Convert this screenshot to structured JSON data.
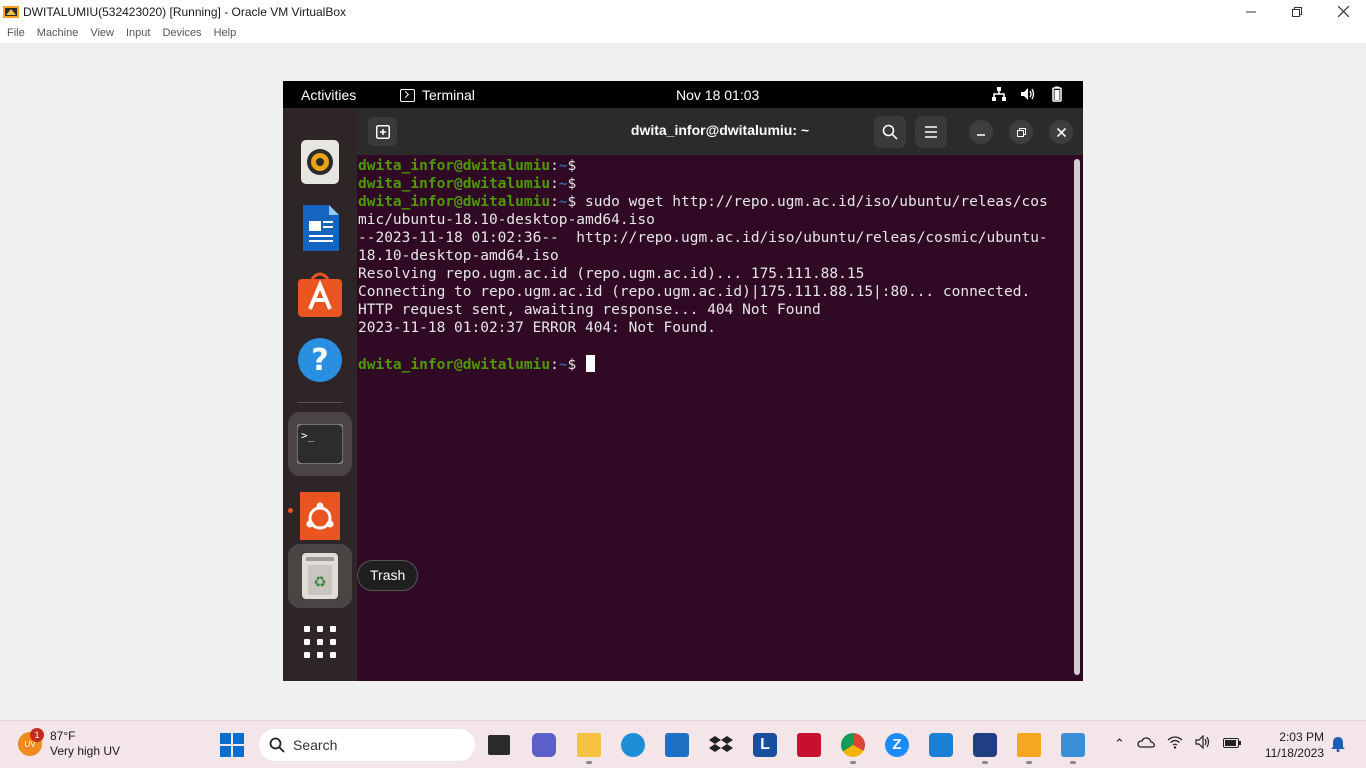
{
  "vbox": {
    "title": "DWITALUMIU(532423020) [Running] - Oracle VM VirtualBox",
    "menu": [
      "File",
      "Machine",
      "View",
      "Input",
      "Devices",
      "Help"
    ]
  },
  "ubuntu": {
    "activities": "Activities",
    "app_menu": "Terminal",
    "clock": "Nov 18  01:03",
    "dock_tooltip": "Trash"
  },
  "terminal": {
    "title": "dwita_infor@dwitalumiu: ~",
    "prompt_user": "dwita_infor@dwitalumiu",
    "prompt_sep": ":",
    "prompt_path": "~",
    "prompt_end": "$",
    "command": " sudo wget http://repo.ugm.ac.id/iso/ubuntu/releas/cos",
    "output": [
      "mic/ubuntu-18.10-desktop-amd64.iso",
      "--2023-11-18 01:02:36--  http://repo.ugm.ac.id/iso/ubuntu/releas/cosmic/ubuntu-",
      "18.10-desktop-amd64.iso",
      "Resolving repo.ugm.ac.id (repo.ugm.ac.id)... 175.111.88.15",
      "Connecting to repo.ugm.ac.id (repo.ugm.ac.id)|175.111.88.15|:80... connected.",
      "HTTP request sent, awaiting response... 404 Not Found",
      "2023-11-18 01:02:37 ERROR 404: Not Found."
    ]
  },
  "taskbar": {
    "weather_temp": "87°F",
    "weather_desc": "Very high UV",
    "weather_badge": "1",
    "search_label": "Search",
    "time": "2:03 PM",
    "date": "11/18/2023"
  }
}
